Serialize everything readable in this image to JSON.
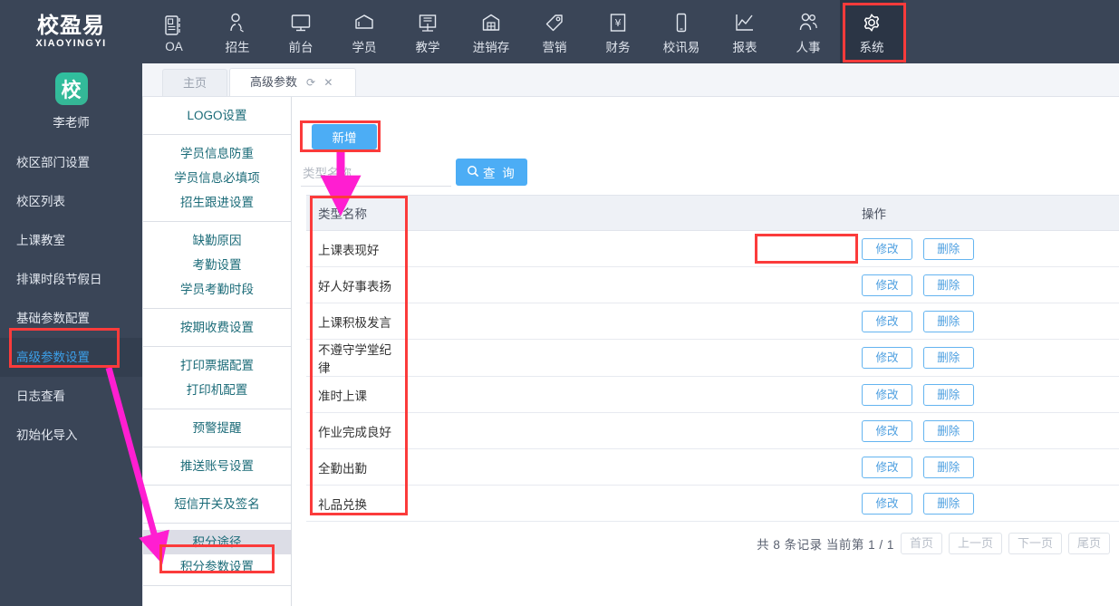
{
  "brand": {
    "name_cn": "校盈易",
    "name_en": "XIAOYINGYI"
  },
  "topnav": {
    "items": [
      {
        "label": "OA",
        "icon": "contact-card-icon",
        "active": false
      },
      {
        "label": "招生",
        "icon": "user-add-icon",
        "active": false
      },
      {
        "label": "前台",
        "icon": "monitor-icon",
        "active": false
      },
      {
        "label": "学员",
        "icon": "graduate-cap-icon",
        "active": false
      },
      {
        "label": "教学",
        "icon": "book-icon",
        "active": false
      },
      {
        "label": "进销存",
        "icon": "warehouse-icon",
        "active": false
      },
      {
        "label": "营销",
        "icon": "tag-icon",
        "active": false
      },
      {
        "label": "财务",
        "icon": "yuan-note-icon",
        "active": false
      },
      {
        "label": "校讯易",
        "icon": "mobile-icon",
        "active": false
      },
      {
        "label": "报表",
        "icon": "chart-line-icon",
        "active": false
      },
      {
        "label": "人事",
        "icon": "people-icon",
        "active": false
      },
      {
        "label": "系统",
        "icon": "gear-icon",
        "active": true
      }
    ]
  },
  "sidebar": {
    "avatar_char": "校",
    "user_name": "李老师",
    "items": [
      {
        "label": "校区部门设置",
        "selected": false
      },
      {
        "label": "校区列表",
        "selected": false
      },
      {
        "label": "上课教室",
        "selected": false
      },
      {
        "label": "排课时段节假日",
        "selected": false
      },
      {
        "label": "基础参数配置",
        "selected": false
      },
      {
        "label": "高级参数设置",
        "selected": true
      },
      {
        "label": "日志查看",
        "selected": false
      },
      {
        "label": "初始化导入",
        "selected": false
      }
    ]
  },
  "submenu": {
    "groups": [
      {
        "items": [
          {
            "label": "LOGO设置",
            "current": false
          }
        ]
      },
      {
        "items": [
          {
            "label": "学员信息防重",
            "current": false
          },
          {
            "label": "学员信息必填项",
            "current": false
          },
          {
            "label": "招生跟进设置",
            "current": false
          }
        ]
      },
      {
        "items": [
          {
            "label": "缺勤原因",
            "current": false
          },
          {
            "label": "考勤设置",
            "current": false
          },
          {
            "label": "学员考勤时段",
            "current": false
          }
        ]
      },
      {
        "items": [
          {
            "label": "按期收费设置",
            "current": false
          }
        ]
      },
      {
        "items": [
          {
            "label": "打印票据配置",
            "current": false
          },
          {
            "label": "打印机配置",
            "current": false
          }
        ]
      },
      {
        "items": [
          {
            "label": "预警提醒",
            "current": false
          }
        ]
      },
      {
        "items": [
          {
            "label": "推送账号设置",
            "current": false
          }
        ]
      },
      {
        "items": [
          {
            "label": "短信开关及签名",
            "current": false
          }
        ]
      },
      {
        "items": [
          {
            "label": "积分途径",
            "current": true
          },
          {
            "label": "积分参数设置",
            "current": false
          }
        ]
      }
    ]
  },
  "tabs": [
    {
      "label": "主页",
      "active": false,
      "tools": ""
    },
    {
      "label": "高级参数",
      "active": true,
      "tools": "⟳ ✕"
    }
  ],
  "toolbar": {
    "add_label": "新增",
    "search_placeholder": "类型名称",
    "search_value": "",
    "search_label": "查 询",
    "search_icon": "magnifier-icon"
  },
  "table": {
    "columns": [
      "类型名称",
      "",
      "操作"
    ],
    "rows": [
      {
        "name": "上课表现好",
        "edit": "修改",
        "delete": "删除"
      },
      {
        "name": "好人好事表扬",
        "edit": "修改",
        "delete": "删除"
      },
      {
        "name": "上课积极发言",
        "edit": "修改",
        "delete": "删除"
      },
      {
        "name": "不遵守学堂纪律",
        "edit": "修改",
        "delete": "删除"
      },
      {
        "name": "准时上课",
        "edit": "修改",
        "delete": "删除"
      },
      {
        "name": "作业完成良好",
        "edit": "修改",
        "delete": "删除"
      },
      {
        "name": "全勤出勤",
        "edit": "修改",
        "delete": "删除"
      },
      {
        "name": "礼品兑换",
        "edit": "修改",
        "delete": "删除"
      }
    ]
  },
  "pager": {
    "summary": "共 8 条记录 当前第 1 / 1",
    "first": "首页",
    "prev": "上一页",
    "next": "下一页",
    "last": "尾页"
  },
  "annotations": {
    "highlight_color": "#fb3b3b",
    "arrow_color": "#ff1ed1"
  }
}
